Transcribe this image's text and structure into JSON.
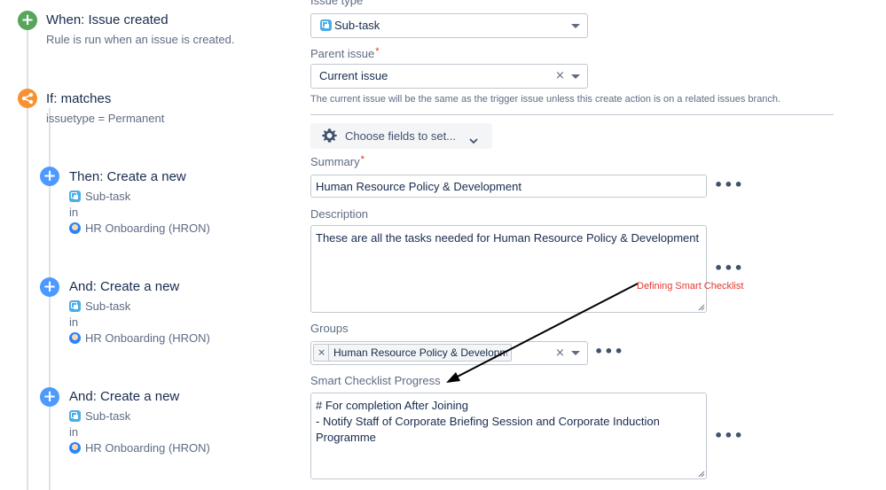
{
  "rule_steps": {
    "trigger": {
      "title": "When: Issue created",
      "description": "Rule is run when an issue is created."
    },
    "condition": {
      "title": "If: matches",
      "description": "issuetype = Permanent"
    },
    "actions": [
      {
        "title": "Then: Create a new",
        "issue_type": "Sub-task",
        "in_label": "in",
        "project": "HR Onboarding (HRON)"
      },
      {
        "title": "And: Create a new",
        "issue_type": "Sub-task",
        "in_label": "in",
        "project": "HR Onboarding (HRON)"
      },
      {
        "title": "And: Create a new",
        "issue_type": "Sub-task",
        "in_label": "in",
        "project": "HR Onboarding (HRON)"
      }
    ]
  },
  "form": {
    "issue_type": {
      "label": "Issue type",
      "value": "Sub-task"
    },
    "parent_issue": {
      "label": "Parent issue",
      "required_mark": "*",
      "value": "Current issue",
      "clear": "×",
      "help": "The current issue will be the same as the trigger issue unless this create action is on a related issues branch."
    },
    "choose_fields": {
      "label": "Choose fields to set..."
    },
    "summary": {
      "label": "Summary",
      "required_mark": "*",
      "value": "Human Resource Policy & Development",
      "more": "•••"
    },
    "description": {
      "label": "Description",
      "value": "These are all the tasks needed for Human Resource Policy & Development",
      "more": "•••"
    },
    "groups": {
      "label": "Groups",
      "tag_remove": "×",
      "tag": "Human Resource Policy & Developm...",
      "clear": "×",
      "more": "•••"
    },
    "smart_checklist": {
      "label": "Smart Checklist Progress",
      "lines": [
        "# For completion After Joining",
        "- Notify Staff of Corporate Briefing Session and Corporate Induction",
        "Programme"
      ],
      "more": "•••"
    }
  },
  "annotation": {
    "text": "Defining Smart Checklist",
    "color": "#e5372f"
  },
  "colors": {
    "trigger": "#57a55a",
    "condition": "#f79232",
    "action": "#4c9aff",
    "accent": "#0052cc"
  },
  "icons": {
    "plus": "+",
    "branch": "branch-icon",
    "gear": "gear-icon",
    "chevron": "chevron-down-icon"
  }
}
